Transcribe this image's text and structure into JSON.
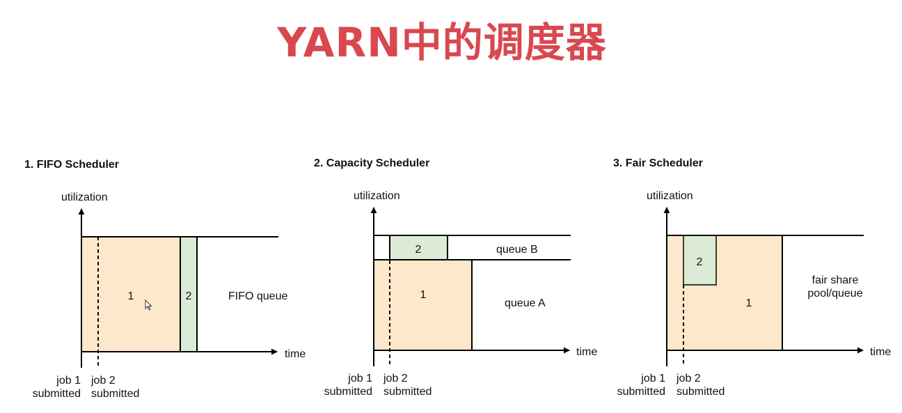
{
  "title": "YARN中的调度器",
  "colors": {
    "title": "#d9484f",
    "job1_fill": "#fde8cb",
    "job2_fill": "#dcebd6",
    "stroke": "#000000"
  },
  "fifo": {
    "heading": "1. FIFO Scheduler",
    "y_axis": "utilization",
    "x_axis": "time",
    "job1": "1",
    "job2": "2",
    "queue": "FIFO queue",
    "job1_line1": "job 1",
    "job1_line2": "submitted",
    "job2_line1": "job 2",
    "job2_line2": "submitted"
  },
  "capacity": {
    "heading": "2. Capacity Scheduler",
    "y_axis": "utilization",
    "x_axis": "time",
    "job1": "1",
    "job2": "2",
    "queue_b": "queue B",
    "queue_a": "queue A",
    "job1_line1": "job 1",
    "job1_line2": "submitted",
    "job2_line1": "job 2",
    "job2_line2": "submitted"
  },
  "fair": {
    "heading": "3. Fair Scheduler",
    "y_axis": "utilization",
    "x_axis": "time",
    "job1": "1",
    "job2": "2",
    "pool_line1": "fair share",
    "pool_line2": "pool/queue",
    "job1_line1": "job 1",
    "job1_line2": "submitted",
    "job2_line1": "job 2",
    "job2_line2": "submitted"
  }
}
